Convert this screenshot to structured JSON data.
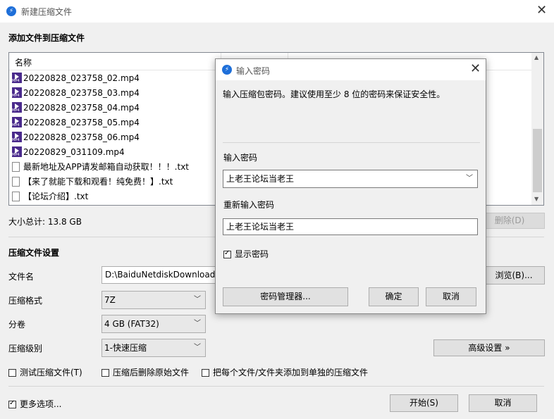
{
  "window": {
    "title": "新建压缩文件"
  },
  "files_section": {
    "title": "添加文件到压缩文件",
    "column_name": "名称",
    "files": [
      {
        "name": "20220828_023758_02.mp4",
        "icon": "mp4-file-icon"
      },
      {
        "name": "20220828_023758_03.mp4",
        "icon": "mp4-file-icon"
      },
      {
        "name": "20220828_023758_04.mp4",
        "icon": "mp4-file-icon"
      },
      {
        "name": "20220828_023758_05.mp4",
        "icon": "mp4-file-icon"
      },
      {
        "name": "20220828_023758_06.mp4",
        "icon": "mp4-file-icon"
      },
      {
        "name": "20220829_031109.mp4",
        "icon": "mp4-file-icon"
      },
      {
        "name": "最新地址及APP请发邮箱自动获取！！！.txt",
        "icon": "txt-file-icon"
      },
      {
        "name": "【来了就能下载和观看！纯免费！】.txt",
        "icon": "txt-file-icon"
      },
      {
        "name": "【论坛介绍】.txt",
        "icon": "txt-file-icon"
      }
    ],
    "total_size": "大小总计: 13.8 GB",
    "delete_button": "删除(D)"
  },
  "settings": {
    "title": "压缩文件设置",
    "filename_label": "文件名",
    "filename_value": "D:\\BaiduNetdiskDownload\\",
    "browse_button": "浏览(B)...",
    "format_label": "压缩格式",
    "format_value": "7Z",
    "volume_label": "分卷",
    "volume_value": "4 GB (FAT32)",
    "level_label": "压缩级别",
    "level_value": "1-快速压缩",
    "advanced_button": "高级设置 »",
    "test_checkbox": "测试压缩文件(T)",
    "delete_after_checkbox": "压缩后删除原始文件",
    "separate_checkbox": "把每个文件/文件夹添加到单独的压缩文件"
  },
  "footer": {
    "more_options": "更多选项...",
    "start_button": "开始(S)",
    "cancel_button": "取消"
  },
  "dialog": {
    "title": "输入密码",
    "description": "输入压缩包密码。建议使用至少 8 位的密码来保证安全性。",
    "password_label": "输入密码",
    "password_value": "上老王论坛当老王",
    "confirm_label": "重新输入密码",
    "confirm_value": "上老王论坛当老王",
    "show_password": "显示密码",
    "manager_button": "密码管理器...",
    "ok_button": "确定",
    "cancel_button": "取消"
  },
  "colors": {
    "accent": "#1e6fd9",
    "window_bg": "#f0f0f0"
  }
}
